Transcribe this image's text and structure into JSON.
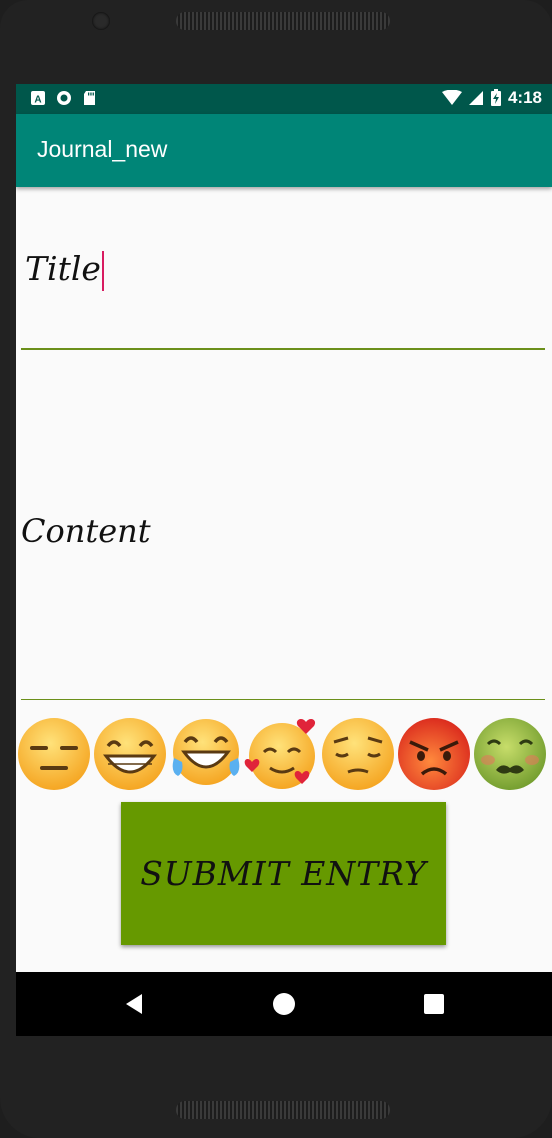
{
  "status_bar": {
    "time": "4:18",
    "icons": [
      "a-notification-icon",
      "record-icon",
      "sd-card-icon",
      "wifi-icon",
      "signal-icon",
      "battery-charging-icon"
    ]
  },
  "app_bar": {
    "title": "Journal_new"
  },
  "form": {
    "title_value": "Title",
    "content_value": "Content"
  },
  "moods": [
    {
      "name": "expressionless"
    },
    {
      "name": "grinning"
    },
    {
      "name": "tears-of-joy"
    },
    {
      "name": "smiling-with-hearts"
    },
    {
      "name": "pensive"
    },
    {
      "name": "angry"
    },
    {
      "name": "nauseated"
    }
  ],
  "submit": {
    "label": "SUBMIT ENTRY",
    "color": "#669900"
  },
  "nav_bar": {
    "buttons": [
      "back-icon",
      "home-icon",
      "recents-icon"
    ]
  },
  "colors": {
    "status_bar": "#00574b",
    "app_bar": "#008577",
    "underline": "#6b8f1a",
    "cursor": "#d81b60"
  }
}
